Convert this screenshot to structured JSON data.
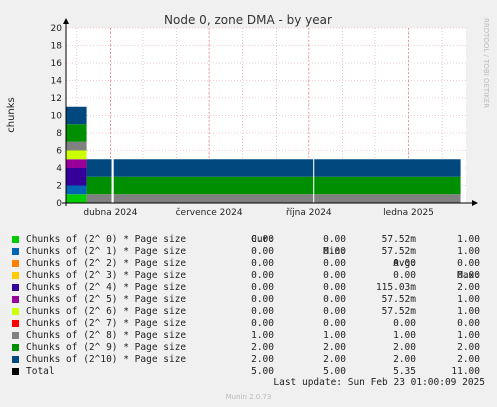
{
  "chart_data": {
    "type": "area",
    "title": "Node 0, zone DMA - by year",
    "ylabel": "chunks",
    "ylim": [
      0,
      20
    ],
    "y_ticks": [
      "0",
      "2",
      "4",
      "6",
      "8",
      "10",
      "12",
      "14",
      "16",
      "18",
      "20"
    ],
    "x_tick_labels": [
      "dubna 2024",
      "července 2024",
      "října 2024",
      "ledna 2025"
    ],
    "x_range": [
      "2024-02-20",
      "2025-02-23"
    ],
    "x_ticks": [
      "2024-04-01",
      "2024-07-01",
      "2024-10-01",
      "2025-01-01"
    ],
    "series": [
      {
        "name": "Chunks of (2^ 0) * Page size",
        "color": "#00cc00",
        "cur": "0.00",
        "min": "0.00",
        "avg": "57.52m",
        "max": "1.00"
      },
      {
        "name": "Chunks of (2^ 1) * Page size",
        "color": "#0066b3",
        "cur": "0.00",
        "min": "0.00",
        "avg": "57.52m",
        "max": "1.00"
      },
      {
        "name": "Chunks of (2^ 2) * Page size",
        "color": "#ff8000",
        "cur": "0.00",
        "min": "0.00",
        "avg": "0.00",
        "max": "0.00"
      },
      {
        "name": "Chunks of (2^ 3) * Page size",
        "color": "#ffcc00",
        "cur": "0.00",
        "min": "0.00",
        "avg": "0.00",
        "max": "0.00"
      },
      {
        "name": "Chunks of (2^ 4) * Page size",
        "color": "#330099",
        "cur": "0.00",
        "min": "0.00",
        "avg": "115.03m",
        "max": "2.00"
      },
      {
        "name": "Chunks of (2^ 5) * Page size",
        "color": "#990099",
        "cur": "0.00",
        "min": "0.00",
        "avg": "57.52m",
        "max": "1.00"
      },
      {
        "name": "Chunks of (2^ 6) * Page size",
        "color": "#ccff00",
        "cur": "0.00",
        "min": "0.00",
        "avg": "57.52m",
        "max": "1.00"
      },
      {
        "name": "Chunks of (2^ 7) * Page size",
        "color": "#ff0000",
        "cur": "0.00",
        "min": "0.00",
        "avg": "0.00",
        "max": "0.00"
      },
      {
        "name": "Chunks of (2^ 8) * Page size",
        "color": "#808080",
        "cur": "1.00",
        "min": "1.00",
        "avg": "1.00",
        "max": "1.00"
      },
      {
        "name": "Chunks of (2^ 9) * Page size",
        "color": "#008f00",
        "cur": "2.00",
        "min": "2.00",
        "avg": "2.00",
        "max": "2.00"
      },
      {
        "name": "Chunks of (2^10) * Page size",
        "color": "#00487d",
        "cur": "2.00",
        "min": "2.00",
        "avg": "2.00",
        "max": "2.00"
      },
      {
        "name": "Total",
        "color": "#000000",
        "cur": "5.00",
        "min": "5.00",
        "avg": "5.35",
        "max": "11.00"
      }
    ],
    "segments": [
      {
        "start": "2024-02-20",
        "end": "2024-03-10",
        "values": [
          1,
          1,
          0,
          0,
          2,
          1,
          1,
          0,
          1,
          2,
          2
        ]
      },
      {
        "start": "2024-03-10",
        "end": "2024-04-02",
        "values": [
          0,
          0,
          0,
          0,
          0,
          0,
          0,
          0,
          1,
          2,
          2
        ]
      },
      {
        "start": "2024-04-04",
        "end": "2024-10-05",
        "values": [
          0,
          0,
          0,
          0,
          0,
          0,
          0,
          0,
          1,
          2,
          2
        ]
      },
      {
        "start": "2024-10-06",
        "end": "2025-02-18",
        "values": [
          0,
          0,
          0,
          0,
          0,
          0,
          0,
          0,
          1,
          2,
          2
        ]
      }
    ]
  },
  "legend_header": {
    "cur": "Cur:",
    "min": "Min:",
    "avg": "Avg:",
    "max": "Max:"
  },
  "last_update": "Last update: Sun Feb 23 01:00:09 2025",
  "side_label": "RRDTOOL / TOBI OETIKER",
  "footer": "Munin 2.0.73"
}
